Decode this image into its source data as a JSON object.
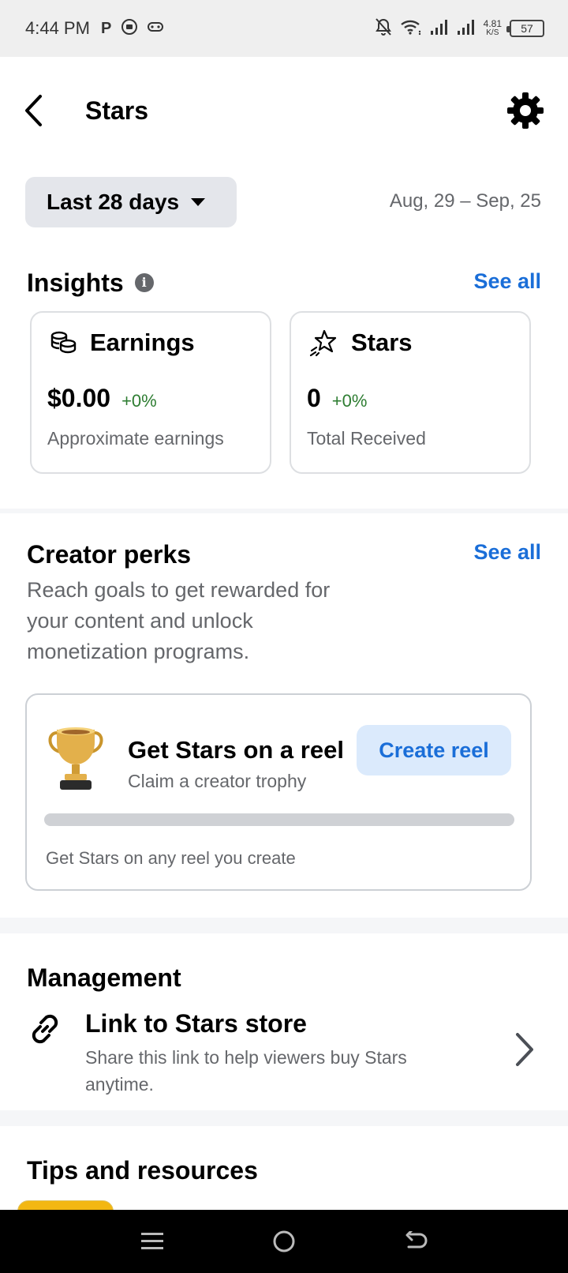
{
  "status_bar": {
    "time": "4:44 PM",
    "speed_value": "4.81",
    "speed_unit": "K/S",
    "battery": "57"
  },
  "header": {
    "title": "Stars"
  },
  "date_filter": {
    "selected": "Last 28 days",
    "range": "Aug, 29 – Sep, 25"
  },
  "insights": {
    "title": "Insights",
    "see_all": "See all",
    "cards": [
      {
        "label": "Earnings",
        "value": "$0.00",
        "change": "+0%",
        "caption": "Approximate earnings"
      },
      {
        "label": "Stars",
        "value": "0",
        "change": "+0%",
        "caption": "Total Received"
      }
    ]
  },
  "creator_perks": {
    "title": "Creator perks",
    "see_all": "See all",
    "description": "Reach goals to get rewarded for your content and unlock monetization programs.",
    "perk": {
      "title": "Get Stars on a reel",
      "subtitle": "Claim a creator trophy",
      "button": "Create reel",
      "progress": 0,
      "footer": "Get Stars on any reel you create"
    }
  },
  "management": {
    "title": "Management",
    "item": {
      "title": "Link to Stars store",
      "description": "Share this link to help viewers buy Stars anytime."
    }
  },
  "tips": {
    "title": "Tips and resources"
  },
  "colors": {
    "accent": "#1a6ed8",
    "positive": "#2e7d32",
    "secondary_text": "#65676b",
    "pill_bg": "#e4e6eb"
  }
}
